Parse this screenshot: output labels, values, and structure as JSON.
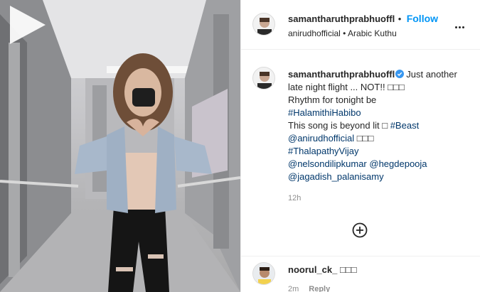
{
  "post": {
    "author": "samantharuthprabhuoffl",
    "author_suffix": "•",
    "follow_label": "Follow",
    "audio_owner": "anirudhofficial",
    "audio_sep": "•",
    "audio_track": "Arabic Kuthu",
    "time_ago": "12h"
  },
  "caption": {
    "author": "samantharuthprabhuoffl",
    "line1": "Just another",
    "line2": "late night flight ... NOT!! □□□",
    "line3": "Rhythm for tonight be",
    "line4": "#HalamithiHabibo",
    "line5_text": "This song is beyond lit □ ",
    "line5_tag": "#Beast",
    "line6_tag": "@anirudhofficial",
    "line6_text": " □□□",
    "line7": "#ThalapathyVijay",
    "line8_a": "@nelsondilipkumar",
    "line8_b": "@hegdepooja",
    "line9": "@jagadish_palanisamy"
  },
  "comment": {
    "user": "noorul_ck_",
    "text": "□□□",
    "time": "2m",
    "reply_label": "Reply"
  },
  "icons": {
    "play": "play-icon",
    "more": "more-options-icon",
    "verified": "verified-badge-icon",
    "add": "add-comment-icon"
  },
  "colors": {
    "follow": "#0095f6",
    "link": "#00376b",
    "muted": "#8e8e8e",
    "verified": "#3897f0"
  }
}
